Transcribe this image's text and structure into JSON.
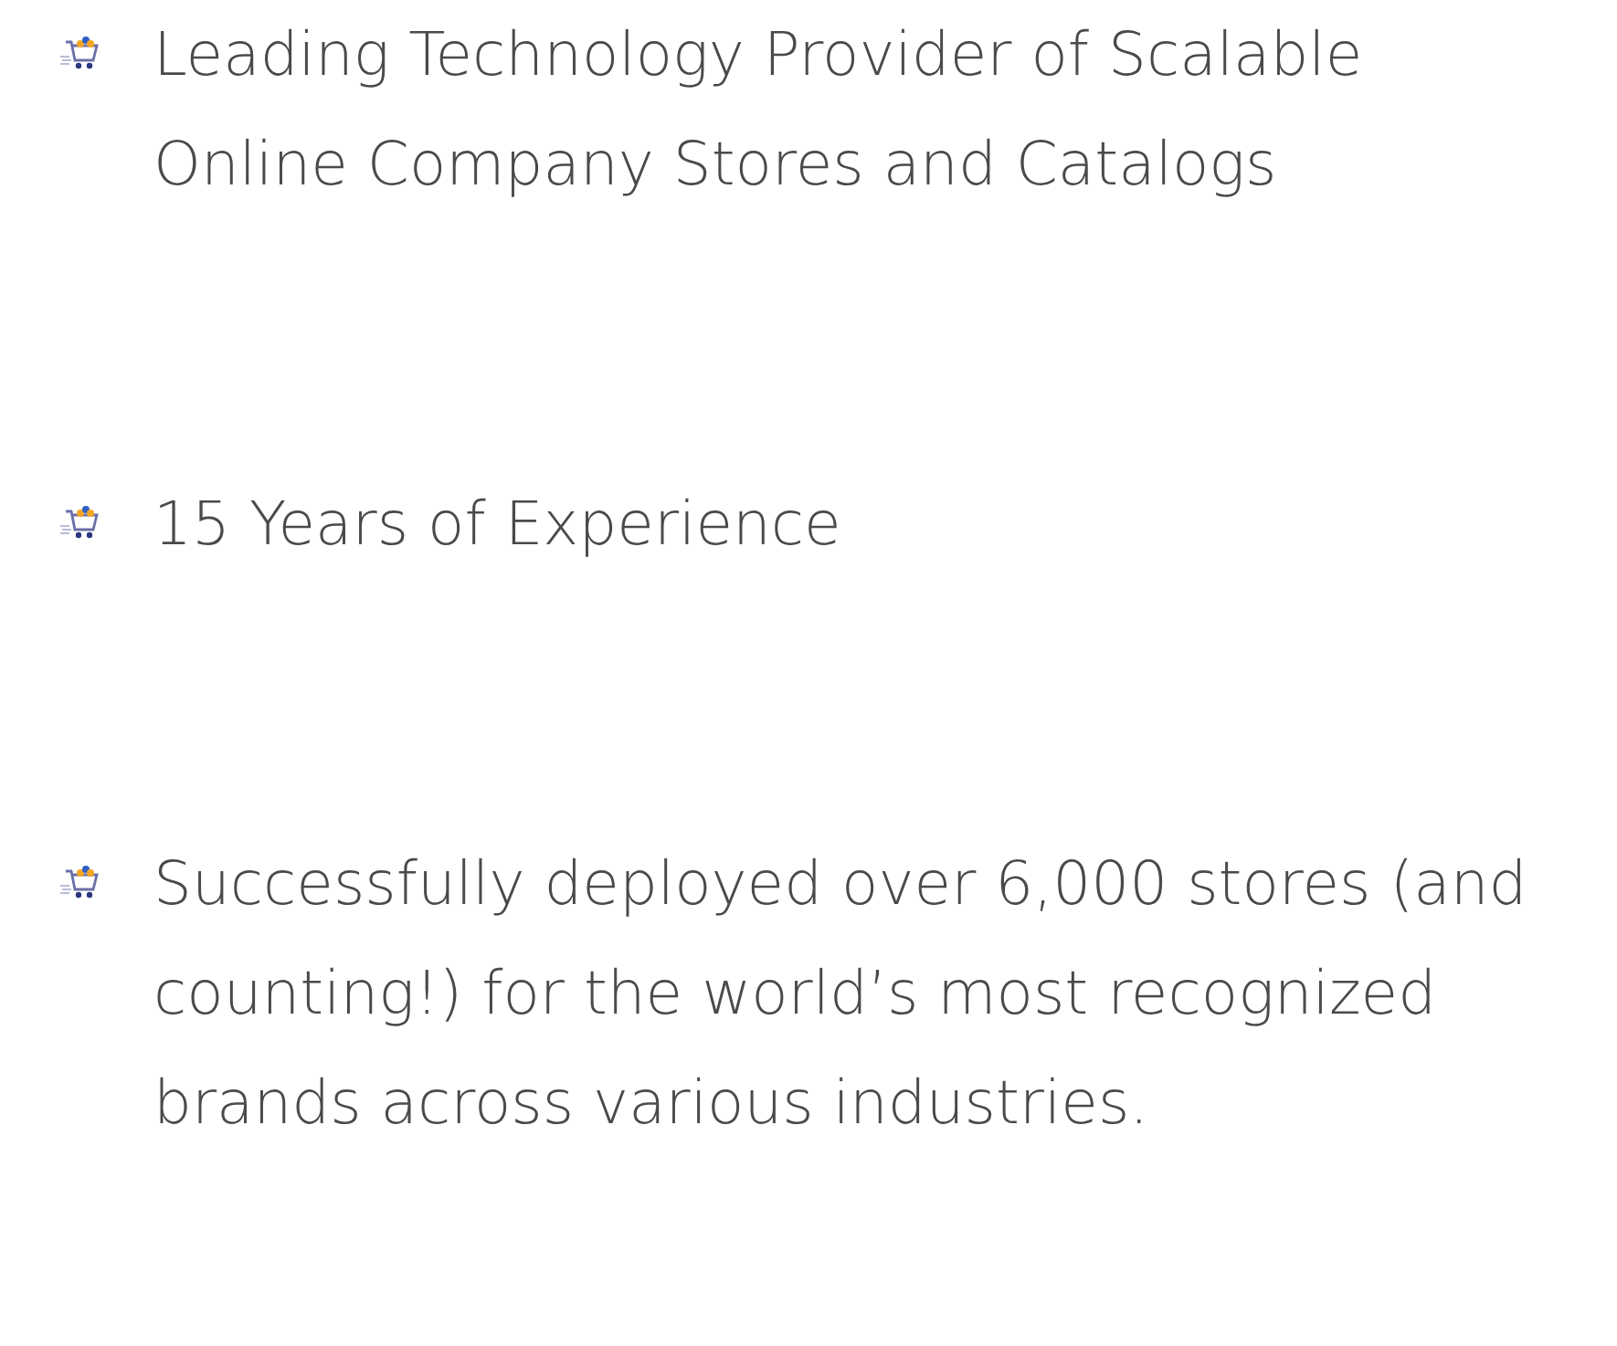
{
  "items": [
    {
      "text": "Leading Technology Provider of Scalable Online Company Stores and Catalogs"
    },
    {
      "text": "15 Years of Experience"
    },
    {
      "text": "Successfully deployed over 6,000 stores (and counting!) for the world’s most recognized brands across various industries."
    }
  ]
}
